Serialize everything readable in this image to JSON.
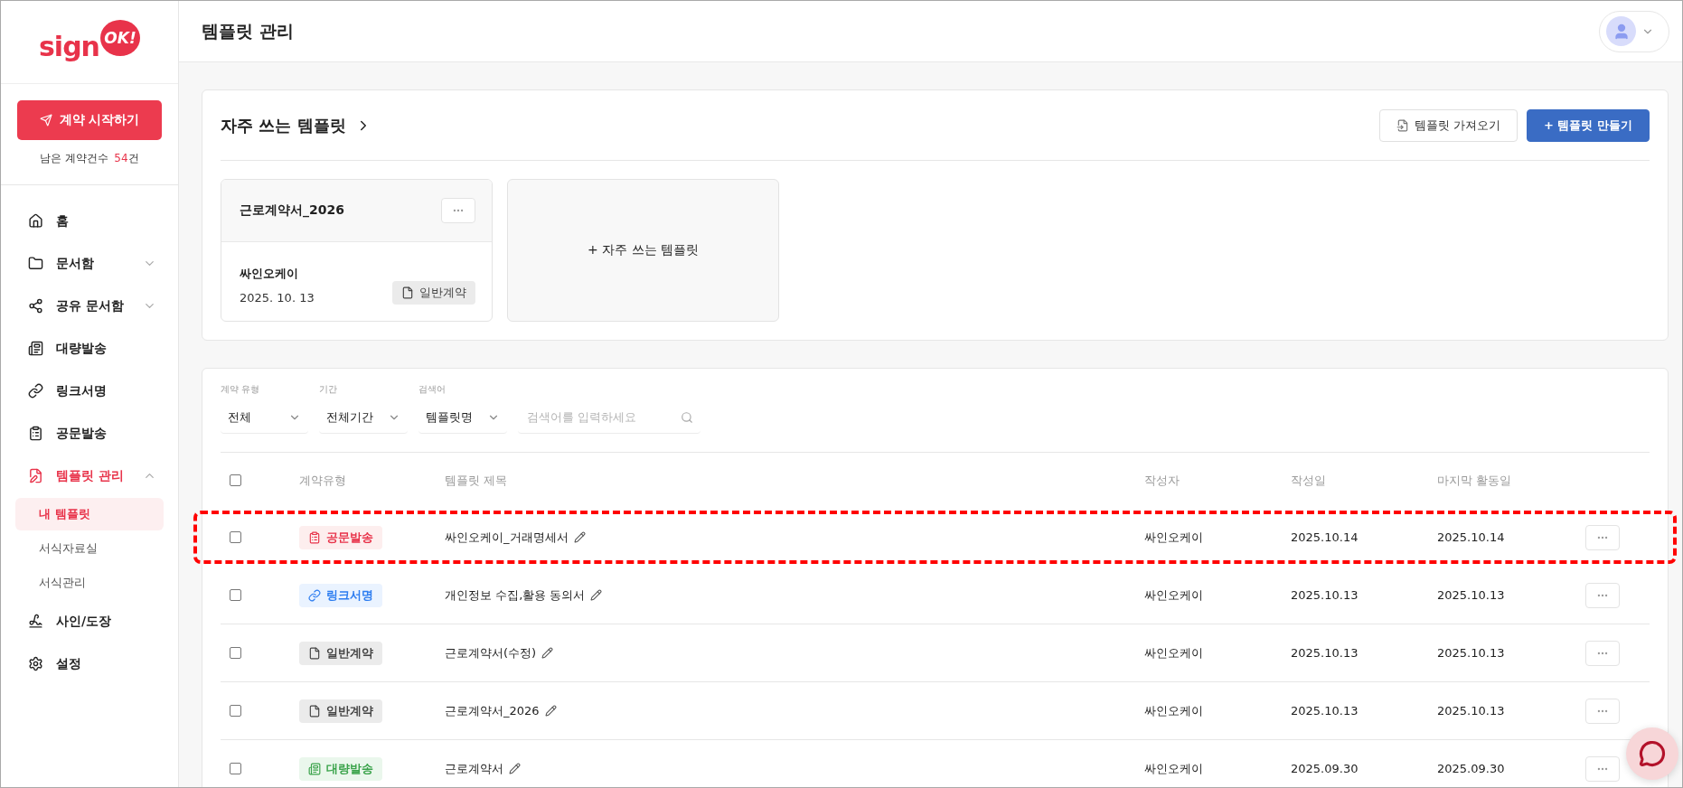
{
  "logo": {
    "text": "sign",
    "badge": "OK!"
  },
  "sidebar": {
    "start_button": "계약 시작하기",
    "remaining": {
      "label": "남은 계약건수",
      "count": "54",
      "unit": "건"
    },
    "items": [
      {
        "kind": "home",
        "label": "홈",
        "selected": false
      },
      {
        "kind": "folder",
        "label": "문서함",
        "selected": false,
        "expanded": false
      },
      {
        "kind": "share",
        "label": "공유 문서함",
        "selected": false,
        "expanded": false
      },
      {
        "kind": "bulk",
        "label": "대량발송",
        "selected": false
      },
      {
        "kind": "link",
        "label": "링크서명",
        "selected": false
      },
      {
        "kind": "official",
        "label": "공문발송",
        "selected": false
      },
      {
        "kind": "template",
        "label": "템플릿 관리",
        "selected": true,
        "expanded": true,
        "children": [
          {
            "label": "내 템플릿",
            "selected": true
          },
          {
            "label": "서식자료실",
            "selected": false
          },
          {
            "label": "서식관리",
            "selected": false
          }
        ]
      },
      {
        "kind": "sign",
        "label": "사인/도장",
        "selected": false
      },
      {
        "kind": "settings",
        "label": "설정",
        "selected": false
      }
    ]
  },
  "header": {
    "title": "템플릿 관리"
  },
  "favorites": {
    "title": "자주 쓰는 템플릿",
    "buttons": [
      {
        "kind": "import",
        "label": "템플릿 가져오기"
      },
      {
        "kind": "create",
        "label": "+ 템플릿 만들기"
      }
    ],
    "cards": [
      {
        "title": "근로계약서_2026",
        "author": "싸인오케이",
        "date": "2025. 10. 13",
        "type": {
          "kind": "general",
          "label": "일반계약"
        }
      }
    ],
    "add_label": "+ 자주 쓰는 템플릿"
  },
  "filters": [
    {
      "label": "계약 유형",
      "value": "전체"
    },
    {
      "label": "기간",
      "value": "전체기간"
    },
    {
      "label": "검색어",
      "value": "템플릿명"
    }
  ],
  "search": {
    "placeholder": "검색어를 입력하세요"
  },
  "table": {
    "select_all": false,
    "columns": [
      "계약유형",
      "템플릿 제목",
      "작성자",
      "작성일",
      "마지막 활동일"
    ],
    "rows": [
      {
        "checked": false,
        "highlighted": true,
        "type": {
          "kind": "official",
          "label": "공문발송"
        },
        "title": "싸인오케이_거래명세서",
        "author": "싸인오케이",
        "created": "2025.10.14",
        "last_active": "2025.10.14"
      },
      {
        "checked": false,
        "highlighted": false,
        "type": {
          "kind": "link",
          "label": "링크서명"
        },
        "title": "개인정보 수집,활용 동의서",
        "author": "싸인오케이",
        "created": "2025.10.13",
        "last_active": "2025.10.13"
      },
      {
        "checked": false,
        "highlighted": false,
        "type": {
          "kind": "general",
          "label": "일반계약"
        },
        "title": "근로계약서(수정)",
        "author": "싸인오케이",
        "created": "2025.10.13",
        "last_active": "2025.10.13"
      },
      {
        "checked": false,
        "highlighted": false,
        "type": {
          "kind": "general",
          "label": "일반계약"
        },
        "title": "근로계약서_2026",
        "author": "싸인오케이",
        "created": "2025.10.13",
        "last_active": "2025.10.13"
      },
      {
        "checked": false,
        "highlighted": false,
        "type": {
          "kind": "bulk",
          "label": "대량발송"
        },
        "title": "근로계약서",
        "author": "싸인오케이",
        "created": "2025.09.30",
        "last_active": "2025.09.30"
      }
    ]
  }
}
